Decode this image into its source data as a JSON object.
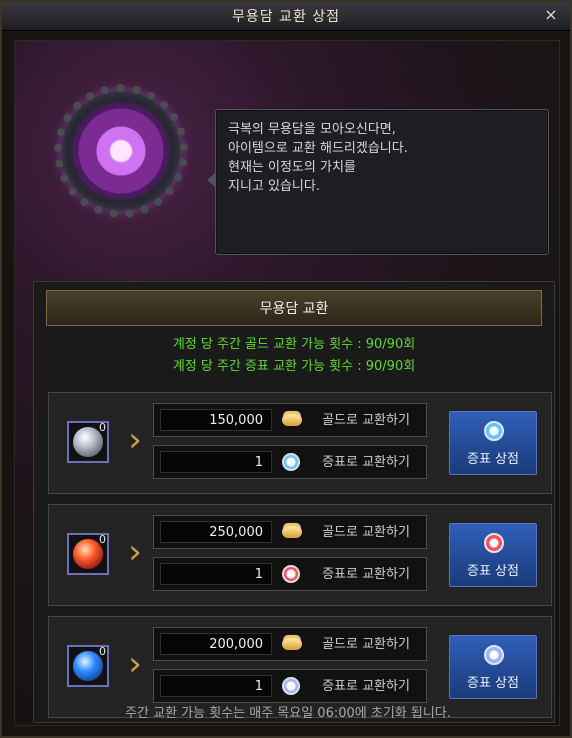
{
  "window": {
    "title": "무용담 교환 상점",
    "close": "×"
  },
  "npc": {
    "dialog": "극복의 무용담을 모아오신다면,\n아이템으로 교환 해드리겠습니다.\n현재는 이정도의 가치를\n지니고 있습니다."
  },
  "exchange": {
    "header": "무용담 교환",
    "gold_limit": "계정 당 주간 골드 교환 가능 횟수 : 90/90회",
    "token_limit": "계정 당 주간 증표 교환 가능 횟수 : 90/90회",
    "rows": [
      {
        "owned": "0",
        "gold_price": "150,000",
        "gold_label": "골드로 교환하기",
        "token_price": "1",
        "token_label": "증표로 교환하기",
        "shop_label": "증표 상점",
        "gem_color": "#b9c0cc",
        "token_color": "#5fc8ff"
      },
      {
        "owned": "0",
        "gold_price": "250,000",
        "gold_label": "골드로 교환하기",
        "token_price": "1",
        "token_label": "증표로 교환하기",
        "shop_label": "증표 상점",
        "gem_color": "#ff5a2b",
        "token_color": "#ff4f5e"
      },
      {
        "owned": "0",
        "gold_price": "200,000",
        "gold_label": "골드로 교환하기",
        "token_price": "1",
        "token_label": "증표로 교환하기",
        "shop_label": "증표 상점",
        "gem_color": "#2c8cff",
        "token_color": "#9bb7ff"
      }
    ]
  },
  "footer": "주간 교환 가능 횟수는 매주 목요일 06:00에 초기화 됩니다."
}
